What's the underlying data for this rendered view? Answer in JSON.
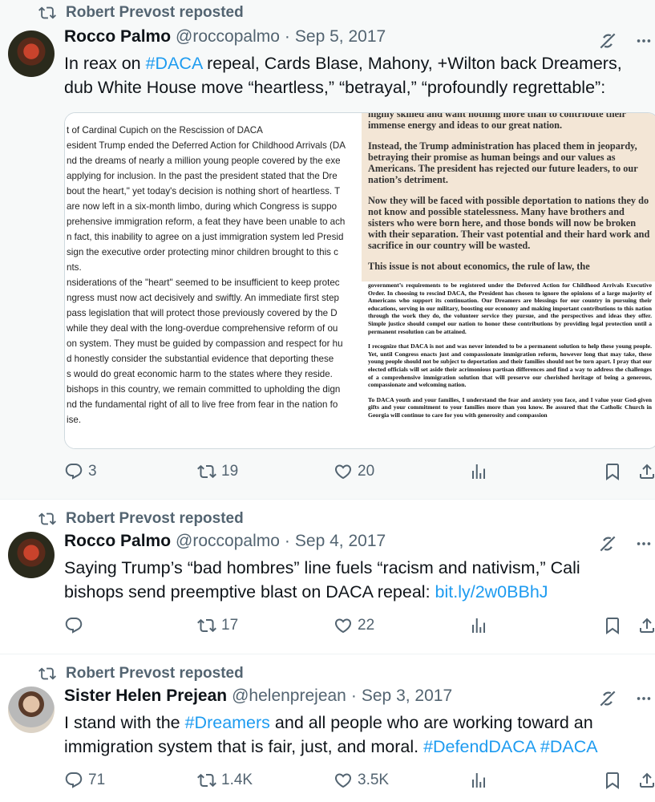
{
  "tweets": [
    {
      "reposted_by": "Robert Prevost reposted",
      "name": "Rocco Palmo",
      "handle": "@roccopalmo",
      "dot": "·",
      "date": "Sep 5, 2017",
      "text_parts": [
        {
          "t": "In reax on ",
          "link": false
        },
        {
          "t": "#DACA",
          "link": true
        },
        {
          "t": " repeal, Cards Blase, Mahony, +Wilton back Dreamers, dub White House move “heartless,” “betrayal,” “profoundly regrettable”:",
          "link": false
        }
      ],
      "media": {
        "left_lines": [
          "t of Cardinal Cupich on the Rescission of DACA",
          "esident Trump ended the Deferred Action for Childhood Arrivals (DA",
          "nd the dreams of nearly a million young people covered by the exe",
          "applying for inclusion. In the past the president stated that the Dre",
          "bout the heart,\" yet today's decision is nothing short of heartless. T",
          "are now left in a six-month limbo, during which Congress is suppo",
          "prehensive immigration reform, a feat they have been unable to ach",
          "n fact, this inability to agree on a just immigration system led Presid",
          "sign the executive order protecting minor children brought to this c",
          "nts.",
          "nsiderations of the \"heart\" seemed to be insufficient to keep protec",
          "ngress must now act decisively and swiftly. An immediate first step",
          "pass legislation that will protect those previously covered by the D",
          "while they deal with the long-overdue comprehensive reform of ou",
          "on system. They must be guided by compassion and respect for hu",
          "d honestly consider the substantial evidence that deporting these",
          "s would do great economic harm to the states where they reside.",
          "bishops in this country, we remain committed to upholding the dign",
          "nd the fundamental right of all to live free from fear in the nation fo",
          "ise."
        ],
        "letter_paragraphs": [
          "highly skilled and want nothing more than to contribute their immense energy and ideas to our great nation.",
          "Instead, the Trump administration has placed them in jeopardy, betraying their promise as human beings and our values as Americans.  The president has rejected our future leaders, to our nation’s detriment.",
          "Now they will be faced with possible deportation to nations they do not know and possible statelessness. Many have brothers and sisters who were born here, and those bonds will now be broken with their separation. Their vast potential and their hard work and sacrifice in our country will be wasted.",
          "This issue is not about economics, the rule of law, the"
        ],
        "press_paragraphs": [
          "government’s requirements to be registered under the Deferred Action for Childhood Arrivals Executive Order.  In choosing to rescind DACA, the President has chosen to ignore the opinions of a large majority of Americans who support its continuation. Our Dreamers are blessings for our country in pursuing their educations, serving in our military, boosting our economy and making important contributions to this nation through the work they do, the volunteer service they pursue, and the perspectives and ideas they offer. Simple justice should compel our nation to honor these contributions by providing legal protection until a permanent resolution can be attained.",
          "I recognize that DACA is not and was never intended to be a permanent solution to help these young people. Yet, until Congress enacts just and compassionate immigration reform, however long that may take, these young people should not be subject to deportation and their families should not be torn apart. I pray that our elected officials will set aside their acrimonious partisan differences and find a way to address the challenges of a comprehensive immigration solution that will preserve our cherished heritage of being a generous, compassionate and welcoming nation.",
          "To DACA youth and your families, I understand the fear and anxiety you face, and I value your God-given gifts and your commitment to your families more than you know.  Be assured that the Catholic Church in Georgia will continue to care for you with generosity and compassion"
        ]
      },
      "replies": "3",
      "reposts": "19",
      "likes": "20"
    },
    {
      "reposted_by": "Robert Prevost reposted",
      "name": "Rocco Palmo",
      "handle": "@roccopalmo",
      "dot": "·",
      "date": "Sep 4, 2017",
      "text_parts": [
        {
          "t": "Saying Trump’s “bad hombres” line fuels “racism and nativism,” Cali bishops send preemptive blast on DACA repeal: ",
          "link": false
        },
        {
          "t": "bit.ly/2w0BBhJ",
          "link": true
        }
      ],
      "replies": "",
      "reposts": "17",
      "likes": "22"
    },
    {
      "reposted_by": "Robert Prevost reposted",
      "name": "Sister Helen Prejean",
      "handle": "@helenprejean",
      "dot": "·",
      "date": "Sep 3, 2017",
      "text_parts": [
        {
          "t": "I stand with the ",
          "link": false
        },
        {
          "t": "#Dreamers",
          "link": true
        },
        {
          "t": " and all people who are working toward an immigration system that is fair, just, and moral. ",
          "link": false
        },
        {
          "t": "#DefendDACA",
          "link": true
        },
        {
          "t": " ",
          "link": false
        },
        {
          "t": "#DACA",
          "link": true
        }
      ],
      "replies": "71",
      "reposts": "1.4K",
      "likes": "3.5K"
    }
  ],
  "icons": {
    "repost": "repost-icon",
    "grok": "grok-icon",
    "more": "more-icon",
    "reply": "reply-icon",
    "like": "heart-icon",
    "views": "views-icon",
    "bookmark": "bookmark-icon",
    "share": "share-icon"
  },
  "colors": {
    "text": "#0f1419",
    "muted": "#536471",
    "link": "#1d9bf0",
    "highlight_bg": "#f7f9f9",
    "letter_bg": "#f3e6d6"
  }
}
